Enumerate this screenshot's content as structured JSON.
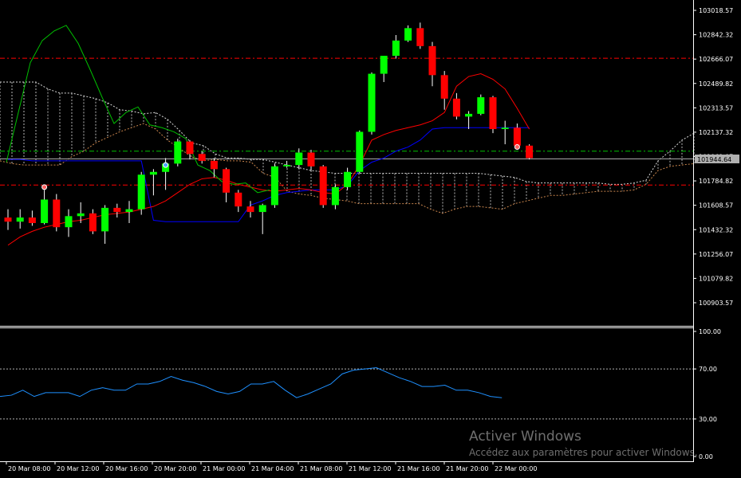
{
  "colors": {
    "background": "#000000",
    "bull_candle": "#00ff00",
    "bear_candle": "#ff0000",
    "wick": "#ffffff",
    "tenkan": "#ff0000",
    "kijun": "#0000ff",
    "chikou": "#00c000",
    "kumo": "#d8d8d8",
    "senkou_b": "#c8844c",
    "red_level": "#ff0000",
    "green_level": "#00c000",
    "bid_line": "#b0b0b0",
    "oscillator": "#1e90ff",
    "osc_level": "#b0b0b0"
  },
  "chart_data": [
    {
      "type": "candlestick",
      "price_axis": [
        "103018.57",
        "102842.32",
        "102666.07",
        "102489.82",
        "102313.57",
        "102137.32",
        "101961.07",
        "101784.82",
        "101608.57",
        "101432.32",
        "101256.07",
        "101079.82",
        "100903.57"
      ],
      "current_price": "101944.64",
      "time_axis": [
        "20 Mar 08:00",
        "20 Mar 12:00",
        "20 Mar 16:00",
        "20 Mar 20:00",
        "21 Mar 00:00",
        "21 Mar 04:00",
        "21 Mar 08:00",
        "21 Mar 12:00",
        "21 Mar 16:00",
        "21 Mar 20:00",
        "22 Mar 00:00"
      ],
      "levels": {
        "red_dashdot_upper": 102672,
        "red_dashdot_lower": 101755,
        "green_dashdot": 102000,
        "bid": 101944.64
      },
      "candles": [
        {
          "o": 101520,
          "h": 101580,
          "l": 101430,
          "c": 101490
        },
        {
          "o": 101490,
          "h": 101580,
          "l": 101440,
          "c": 101520
        },
        {
          "o": 101520,
          "h": 101570,
          "l": 101460,
          "c": 101480
        },
        {
          "o": 101480,
          "h": 101720,
          "l": 101470,
          "c": 101650
        },
        {
          "o": 101650,
          "h": 101690,
          "l": 101420,
          "c": 101450
        },
        {
          "o": 101450,
          "h": 101580,
          "l": 101380,
          "c": 101530
        },
        {
          "o": 101530,
          "h": 101630,
          "l": 101480,
          "c": 101550
        },
        {
          "o": 101550,
          "h": 101580,
          "l": 101400,
          "c": 101420
        },
        {
          "o": 101420,
          "h": 101610,
          "l": 101330,
          "c": 101590
        },
        {
          "o": 101590,
          "h": 101620,
          "l": 101520,
          "c": 101560
        },
        {
          "o": 101560,
          "h": 101640,
          "l": 101480,
          "c": 101580
        },
        {
          "o": 101580,
          "h": 101850,
          "l": 101540,
          "c": 101830
        },
        {
          "o": 101830,
          "h": 101870,
          "l": 101680,
          "c": 101850
        },
        {
          "o": 101850,
          "h": 101950,
          "l": 101720,
          "c": 101910
        },
        {
          "o": 101910,
          "h": 102090,
          "l": 101890,
          "c": 102070
        },
        {
          "o": 102070,
          "h": 102080,
          "l": 101940,
          "c": 101980
        },
        {
          "o": 101980,
          "h": 102000,
          "l": 101910,
          "c": 101930
        },
        {
          "o": 101930,
          "h": 101950,
          "l": 101810,
          "c": 101870
        },
        {
          "o": 101870,
          "h": 101880,
          "l": 101630,
          "c": 101700
        },
        {
          "o": 101700,
          "h": 101720,
          "l": 101560,
          "c": 101600
        },
        {
          "o": 101600,
          "h": 101640,
          "l": 101520,
          "c": 101560
        },
        {
          "o": 101560,
          "h": 101620,
          "l": 101400,
          "c": 101610
        },
        {
          "o": 101610,
          "h": 101910,
          "l": 101590,
          "c": 101890
        },
        {
          "o": 101890,
          "h": 101930,
          "l": 101880,
          "c": 101900
        },
        {
          "o": 101900,
          "h": 102020,
          "l": 101870,
          "c": 101990
        },
        {
          "o": 101990,
          "h": 102010,
          "l": 101860,
          "c": 101890
        },
        {
          "o": 101890,
          "h": 101900,
          "l": 101590,
          "c": 101610
        },
        {
          "o": 101610,
          "h": 101760,
          "l": 101580,
          "c": 101740
        },
        {
          "o": 101740,
          "h": 101880,
          "l": 101720,
          "c": 101850
        },
        {
          "o": 101850,
          "h": 102150,
          "l": 101840,
          "c": 102140
        },
        {
          "o": 102140,
          "h": 102570,
          "l": 102120,
          "c": 102560
        },
        {
          "o": 102560,
          "h": 102690,
          "l": 102500,
          "c": 102690
        },
        {
          "o": 102690,
          "h": 102840,
          "l": 102670,
          "c": 102800
        },
        {
          "o": 102800,
          "h": 102910,
          "l": 102790,
          "c": 102890
        },
        {
          "o": 102890,
          "h": 102930,
          "l": 102740,
          "c": 102760
        },
        {
          "o": 102760,
          "h": 102790,
          "l": 102470,
          "c": 102550
        },
        {
          "o": 102550,
          "h": 102580,
          "l": 102300,
          "c": 102380
        },
        {
          "o": 102380,
          "h": 102420,
          "l": 102230,
          "c": 102250
        },
        {
          "o": 102250,
          "h": 102290,
          "l": 102160,
          "c": 102270
        },
        {
          "o": 102270,
          "h": 102410,
          "l": 102260,
          "c": 102390
        },
        {
          "o": 102390,
          "h": 102400,
          "l": 102130,
          "c": 102160
        },
        {
          "o": 102160,
          "h": 102220,
          "l": 102050,
          "c": 102170
        },
        {
          "o": 102170,
          "h": 102200,
          "l": 102030,
          "c": 102040
        },
        {
          "o": 102040,
          "h": 102050,
          "l": 101940,
          "c": 101950
        }
      ],
      "tenkan": [
        101320,
        101380,
        101420,
        101450,
        101470,
        101490,
        101500,
        101520,
        101540,
        101550,
        101560,
        101580,
        101600,
        101640,
        101700,
        101760,
        101800,
        101810,
        101790,
        101760,
        101740,
        101720,
        101710,
        101720,
        101730,
        101720,
        101700,
        101690,
        101760,
        101900,
        102080,
        102120,
        102150,
        102170,
        102190,
        102220,
        102280,
        102470,
        102540,
        102560,
        102520,
        102450,
        102310,
        102160
      ],
      "kijun": [
        101940,
        101940,
        101930,
        101930,
        101930,
        101930,
        101930,
        101930,
        101930,
        101930,
        101930,
        101930,
        101500,
        101490,
        101490,
        101490,
        101490,
        101490,
        101490,
        101490,
        101610,
        101640,
        101680,
        101700,
        101710,
        101720,
        101720,
        101720,
        101750,
        101860,
        101920,
        101950,
        102000,
        102030,
        102080,
        102160,
        102170,
        102170,
        102170,
        102170,
        102170,
        102170,
        102170,
        102170
      ],
      "chikou": [
        101920,
        102280,
        102640,
        102800,
        102870,
        102910,
        102780,
        102590,
        102390,
        102200,
        102280,
        102320,
        102190,
        102170,
        102140,
        102090,
        101900,
        101860,
        101780,
        101760,
        101770,
        101700,
        101720
      ],
      "senkou_a": [
        102500,
        102500,
        102500,
        102500,
        102450,
        102420,
        102420,
        102400,
        102380,
        102350,
        102300,
        102290,
        102270,
        102280,
        102230,
        102150,
        102060,
        102040,
        101980,
        101950,
        101950,
        101940,
        101940,
        101920,
        101900,
        101880,
        101860,
        101850,
        101840,
        101840,
        101840,
        101840,
        101840,
        101840,
        101840,
        101840,
        101840,
        101840,
        101840,
        101840,
        101840,
        101830,
        101820,
        101810,
        101780,
        101770,
        101770,
        101770,
        101770,
        101770,
        101770,
        101760,
        101760,
        101770,
        101790,
        101930,
        102000,
        102080,
        102130
      ],
      "senkou_b": [
        101930,
        101910,
        101900,
        101900,
        101900,
        101900,
        101960,
        102000,
        102060,
        102100,
        102140,
        102170,
        102200,
        102160,
        102080,
        102020,
        101960,
        101930,
        101940,
        101930,
        101930,
        101920,
        101840,
        101810,
        101710,
        101690,
        101680,
        101660,
        101650,
        101640,
        101620,
        101620,
        101620,
        101620,
        101620,
        101620,
        101580,
        101550,
        101580,
        101600,
        101600,
        101590,
        101580,
        101620,
        101640,
        101660,
        101680,
        101680,
        101690,
        101700,
        101710,
        101710,
        101710,
        101720,
        101760,
        101860,
        101890,
        101900,
        101910
      ],
      "markers": [
        {
          "bar": 3,
          "kind": "arrow-down",
          "price": 101740
        },
        {
          "bar": 13,
          "kind": "arrow-up",
          "price": 101900
        },
        {
          "bar": 42,
          "kind": "arrow-down",
          "price": 102030
        }
      ]
    },
    {
      "type": "line",
      "y_axis": [
        "100.00",
        "70.00",
        "30.00",
        "0.00"
      ],
      "levels": [
        70,
        30
      ],
      "values": [
        48,
        49,
        53,
        48,
        51,
        51,
        51,
        48,
        53,
        55,
        53,
        53,
        58,
        58,
        60,
        64,
        61,
        59,
        56,
        52,
        50,
        52,
        58,
        58,
        60,
        53,
        47,
        50,
        54,
        58,
        66,
        69,
        70,
        71,
        67,
        63,
        60,
        56,
        56,
        57,
        53,
        53,
        51,
        48,
        47
      ]
    }
  ],
  "watermark": {
    "title": "Activer Windows",
    "subtitle": "Accédez aux paramètres pour activer Windows."
  }
}
